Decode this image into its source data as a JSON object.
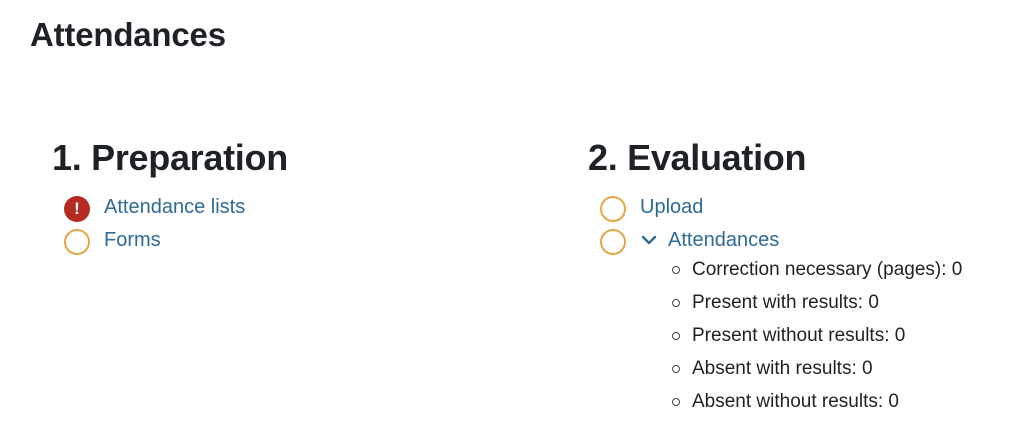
{
  "page": {
    "title": "Attendances"
  },
  "preparation": {
    "title": "1. Preparation",
    "items": [
      {
        "label": "Attendance lists",
        "status": "warning",
        "status_icon": "!"
      },
      {
        "label": "Forms",
        "status": "todo"
      }
    ]
  },
  "evaluation": {
    "title": "2. Evaluation",
    "items": [
      {
        "label": "Upload",
        "status": "todo"
      },
      {
        "label": "Attendances",
        "status": "todo",
        "expanded": true,
        "details": [
          "Correction necessary (pages): 0",
          "Present with results: 0",
          "Present without results: 0",
          "Absent with results: 0",
          "Absent without results: 0"
        ]
      }
    ]
  },
  "colors": {
    "link": "#2e6a95",
    "todo_ring": "#e3a745",
    "warning": "#b52b22",
    "text": "#1e2226"
  },
  "icons": {
    "warning": "exclamation-circle-icon",
    "todo": "empty-circle-icon",
    "expand": "chevron-down-icon",
    "bullet": "hollow-bullet-icon"
  }
}
